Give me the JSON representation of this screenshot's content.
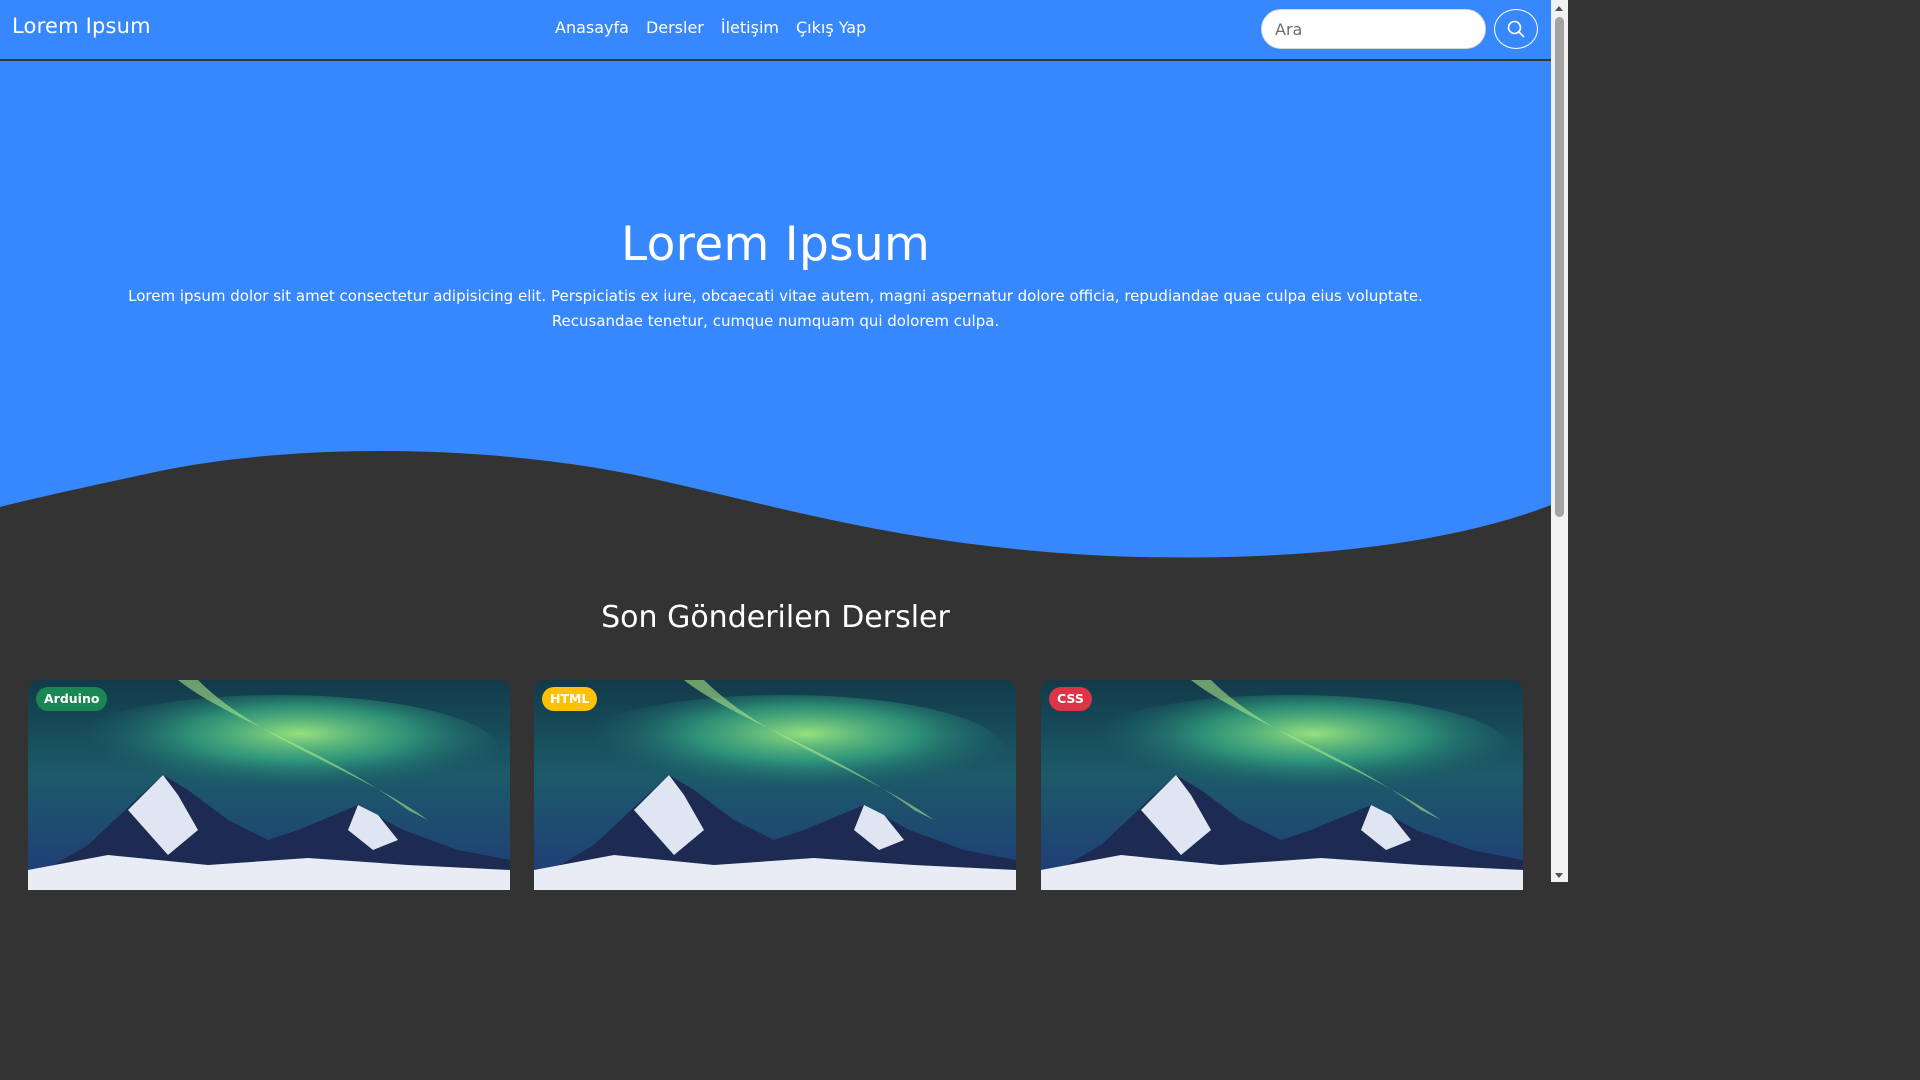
{
  "navbar": {
    "brand": "Lorem Ipsum",
    "links": [
      "Anasayfa",
      "Dersler",
      "İletişim",
      "Çıkış Yap"
    ],
    "search_placeholder": "Ara",
    "search_value": "",
    "search_button_icon": "search-icon"
  },
  "hero": {
    "title": "Lorem Ipsum",
    "text": "Lorem ipsum dolor sit amet consectetur adipisicing elit. Perspiciatis ex iure, obcaecati vitae autem, magni aspernatur dolore officia, repudiandae quae culpa eius voluptate. Recusandae tenetur, cumque numquam qui dolorem culpa."
  },
  "section": {
    "title": "Son Gönderilen Dersler"
  },
  "cards": [
    {
      "badge": "Arduino",
      "badge_color": "#198754",
      "badge_text_color": "#ffffff",
      "image": "aurora-mountain-image"
    },
    {
      "badge": "HTML",
      "badge_color": "#ffc107",
      "badge_text_color": "#ffffff",
      "image": "aurora-mountain-image"
    },
    {
      "badge": "CSS",
      "badge_color": "#dc3545",
      "badge_text_color": "#ffffff",
      "image": "aurora-mountain-image"
    }
  ],
  "colors": {
    "primary": "#3788fd",
    "dark_background": "#333333",
    "text": "#ffffff"
  }
}
